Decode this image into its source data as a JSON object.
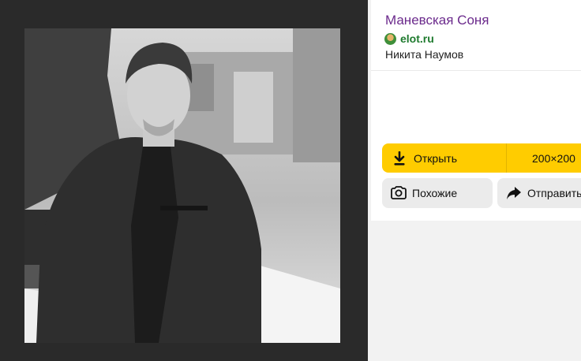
{
  "result": {
    "title": "Маневская Соня",
    "domain": "elot.ru",
    "author": "Никита Наумов"
  },
  "actions": {
    "open_label": "Открыть",
    "size_label": "200×200",
    "similar_label": "Похожие",
    "share_label": "Отправить"
  },
  "icons": {
    "download": "download-icon",
    "camera": "lens-camera-icon",
    "share": "share-arrow-icon"
  },
  "colors": {
    "accent": "#ffcc00",
    "title": "#6b2a8c",
    "domain": "#1e7a2e"
  }
}
